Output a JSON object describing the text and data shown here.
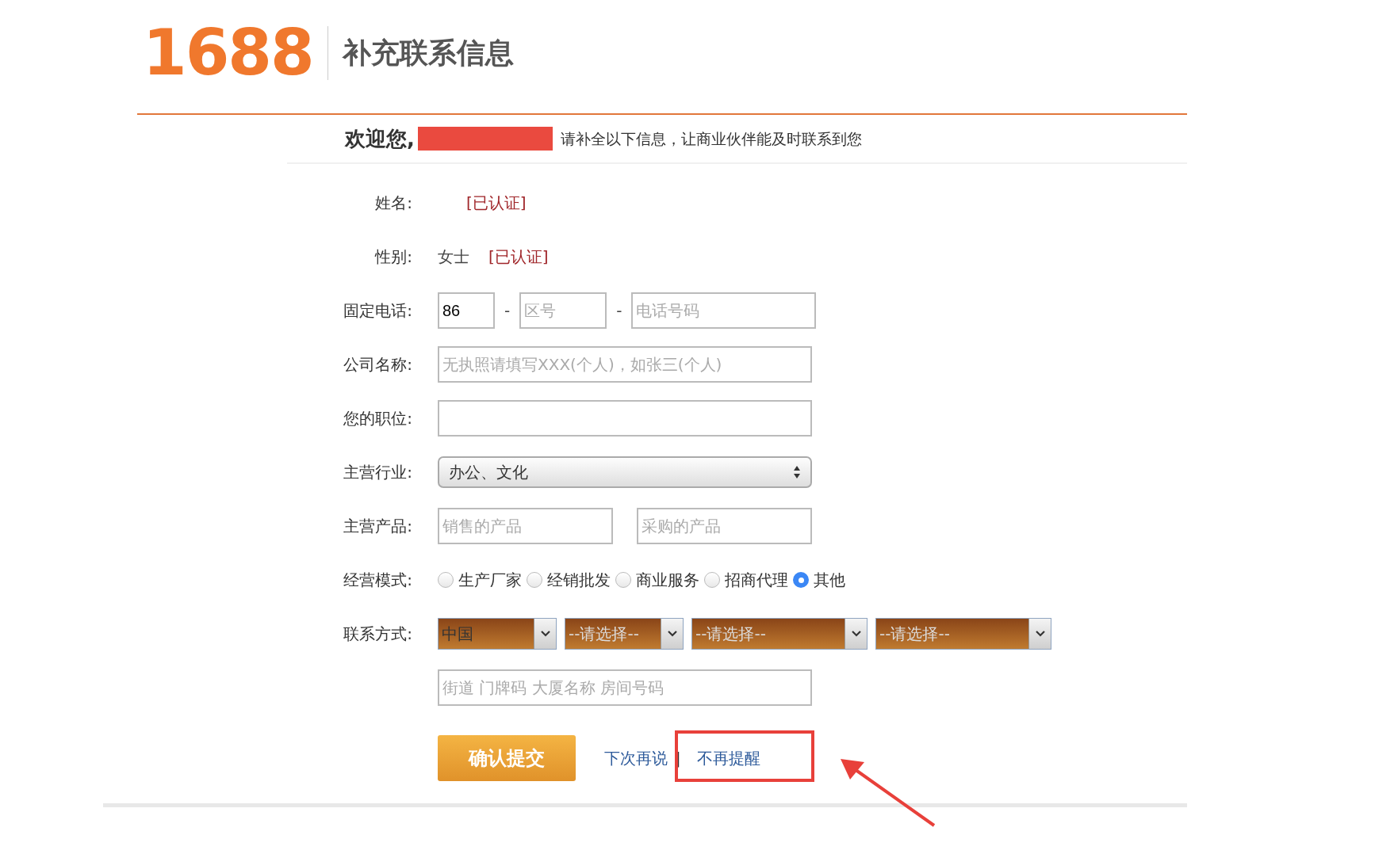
{
  "header": {
    "logo": "1688",
    "title": "补充联系信息"
  },
  "welcome": {
    "greeting": "欢迎您,",
    "message": "请补全以下信息，让商业伙伴能及时联系到您"
  },
  "form": [
    {
      "kind": "verified",
      "label": "姓名:",
      "badge": "[已认证]"
    },
    {
      "kind": "verified",
      "label": "性别:",
      "value": "女士",
      "badge": "[已认证]"
    },
    {
      "kind": "phone",
      "label": "固定电话:",
      "parts": [
        {
          "value": "86"
        },
        {
          "placeholder": "区号"
        },
        {
          "placeholder": "电话号码"
        }
      ],
      "separators": [
        "-",
        "-"
      ]
    },
    {
      "kind": "text",
      "label": "公司名称:",
      "placeholder": "无执照请填写XXX(个人)，如张三(个人)"
    },
    {
      "kind": "text",
      "label": "您的职位:"
    },
    {
      "kind": "select",
      "label": "主营行业:",
      "value": "办公、文化"
    },
    {
      "kind": "pair",
      "label": "主营产品:",
      "placeholders": [
        "销售的产品",
        "采购的产品"
      ]
    },
    {
      "kind": "radio",
      "label": "经营模式:",
      "options": [
        {
          "label": "生产厂家",
          "selected": false
        },
        {
          "label": "经销批发",
          "selected": false
        },
        {
          "label": "商业服务",
          "selected": false
        },
        {
          "label": "招商代理",
          "selected": false
        },
        {
          "label": "其他",
          "selected": true
        }
      ]
    },
    {
      "kind": "selects",
      "label": "联系方式:",
      "options": [
        {
          "value": "中国",
          "chosen": true
        },
        {
          "value": "--请选择--",
          "chosen": false
        },
        {
          "value": "--请选择--",
          "chosen": false
        },
        {
          "value": "--请选择--",
          "chosen": false
        }
      ]
    },
    {
      "kind": "address",
      "placeholder": "街道 门牌码 大厦名称 房间号码"
    }
  ],
  "actions": {
    "submit": "确认提交",
    "later": "下次再说",
    "divider": "|",
    "never": "不再提醒"
  }
}
